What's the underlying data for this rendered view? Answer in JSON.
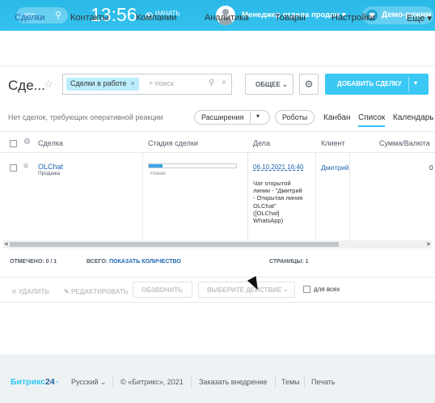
{
  "topbar": {
    "search_placeholder": "иск...",
    "clock": "13:56",
    "start_label": "НАЧАТЬ",
    "user_name": "Менеджер отдела продаж",
    "demo_label": "Демо-режим"
  },
  "menu": {
    "items": [
      "Сделки",
      "Контакты",
      "Компании",
      "Аналитика",
      "Товары",
      "Настройки",
      "Еще"
    ]
  },
  "toolbar": {
    "title": "Сде...",
    "filter_chip": "Сделки в работе",
    "filter_placeholder": "+ поиск",
    "general_label": "ОБЩЕЕ",
    "add_deal_label": "ДОБАВИТЬ СДЕЛКУ"
  },
  "subbar": {
    "notice": "Нет сделок, требующих оперативной реакции",
    "extensions_label": "Расширения",
    "robots_label": "Роботы",
    "views": [
      "Канбан",
      "Список",
      "Календарь"
    ]
  },
  "table": {
    "headers": [
      "Сделка",
      "Стадия сделки",
      "Дела",
      "Клиент",
      "Сумма/Валюта"
    ],
    "row": {
      "deal_name": "OLChat",
      "deal_type": "Продажа",
      "stage_label": "Новая",
      "stage_progress": 0.16,
      "activity_date": "06.10.2021 16:40",
      "activity_desc": "Чат открытой линии - \"Дмитрий - Открытая линия OLChat\" ([OLChat] WhatsApp)",
      "client": "Дмитрий",
      "sum": "0"
    }
  },
  "footer_counts": {
    "marked": "ОТМЕЧЕНО: 0 / 1",
    "total_prefix": "ВСЕГО:",
    "total_link": "ПОКАЗАТЬ КОЛИЧЕСТВО",
    "pages": "СТРАНИЦЫ: 1"
  },
  "actions": {
    "delete": "УДАЛИТЬ",
    "edit": "РЕДАКТИРОВАТЬ",
    "call": "ОБЗВОНИТЬ",
    "choose_action": "ВЫБЕРИТЕ ДЕЙСТВИЕ",
    "for_all": "для всех"
  },
  "page_footer": {
    "brand": "Битрикс",
    "brand_num": "24",
    "language": "Русский",
    "copyright": "© «Битрикс», 2021",
    "order_impl": "Заказать внедрение",
    "themes": "Темы",
    "print": "Печать"
  },
  "colors": {
    "accent": "#2fc6f6",
    "link": "#2067b0",
    "add_button": "#3bc8f5"
  }
}
